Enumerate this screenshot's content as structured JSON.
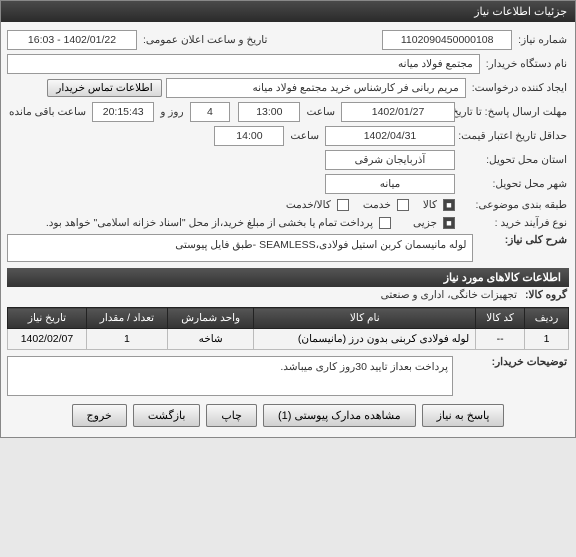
{
  "window_title": "جزئیات اطلاعات نیاز",
  "fields": {
    "req_no_label": "شماره نیاز:",
    "req_no": "1102090450000108",
    "announce_label": "تاریخ و ساعت اعلان عمومی:",
    "announce_value": "1402/01/22 - 16:03",
    "buyer_label": "نام دستگاه خریدار:",
    "buyer_value": "مجتمع فولاد میانه",
    "creator_label": "ایجاد کننده درخواست:",
    "creator_value": "مریم ربانی فر کارشناس خرید مجتمع فولاد میانه",
    "contact_btn": "اطلاعات تماس خریدار",
    "reply_deadline_label": "مهلت ارسال پاسخ: تا تاریخ:",
    "reply_date": "1402/01/27",
    "saat_label": "ساعت",
    "reply_time": "13:00",
    "rooz_label": "روز و",
    "days_left": "4",
    "remaining_time": "20:15:43",
    "remaining_suffix": "ساعت باقی مانده",
    "min_validity_label": "حداقل تاریخ اعتبار قیمت: تا تاریخ:",
    "validity_date": "1402/04/31",
    "validity_time": "14:00",
    "province_label": "استان محل تحویل:",
    "province": "آذربایجان شرقی",
    "city_label": "شهر محل تحویل:",
    "city": "میانه",
    "class_label": "طبقه بندی موضوعی:",
    "class_kala": "کالا",
    "class_khadamat": "خدمت",
    "class_both": "کالا/خدمت",
    "process_label": "نوع فرآیند خرید :",
    "proc_partial": "جزیی",
    "proc_note": "پرداخت تمام یا بخشی از مبلغ خرید،از محل \"اسناد خزانه اسلامی\" خواهد بود.",
    "desc_header": "شرح کلی نیاز:",
    "desc_text": "لوله مانیسمان کربن استیل فولادی،SEAMLESS -طبق فایل پیوستی",
    "goods_section": "اطلاعات کالاهای مورد نیاز",
    "group_label": "گروه کالا:",
    "group_value": "تجهیزات خانگی، اداری و صنعتی"
  },
  "table": {
    "headers": [
      "ردیف",
      "کد کالا",
      "نام کالا",
      "واحد شمارش",
      "تعداد / مقدار",
      "تاریخ نیاز"
    ],
    "rows": [
      {
        "idx": "1",
        "code": "--",
        "name": "لوله فولادی کربنی بدون درز (مانیسمان)",
        "unit": "شاخه",
        "qty": "1",
        "date": "1402/02/07"
      }
    ]
  },
  "buyer_notes_label": "توضیحات خریدار:",
  "buyer_notes": "پرداخت بعداز تایید 30روز کاری میباشد.",
  "footer": {
    "reply": "پاسخ به نیاز",
    "attachments": "مشاهده مدارک پیوستی (1)",
    "print": "چاپ",
    "back": "بازگشت",
    "exit": "خروج"
  }
}
